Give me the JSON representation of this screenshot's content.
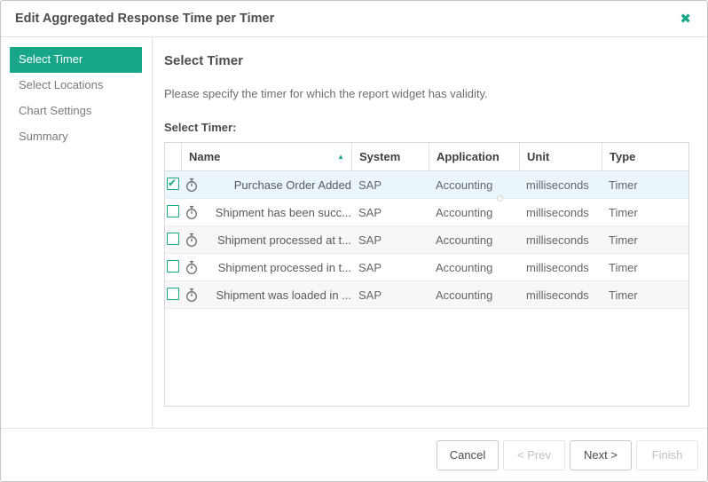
{
  "dialog": {
    "title": "Edit Aggregated Response Time per Timer",
    "close_glyph": "✖"
  },
  "colors": {
    "accent": "#18a689",
    "selected_row": "#eaf6fc",
    "alt_row": "#f7f7f7"
  },
  "sidebar": {
    "items": [
      {
        "label": "Select Timer",
        "active": true
      },
      {
        "label": "Select Locations",
        "active": false
      },
      {
        "label": "Chart Settings",
        "active": false
      },
      {
        "label": "Summary",
        "active": false
      }
    ]
  },
  "main": {
    "heading": "Select Timer",
    "description": "Please specify the timer for which the report widget has validity.",
    "table_label": "Select Timer:",
    "table": {
      "columns": {
        "name": "Name",
        "system": "System",
        "application": "Application",
        "unit": "Unit",
        "type": "Type"
      },
      "sort": {
        "column": "Name",
        "direction": "asc",
        "glyph": "▲"
      },
      "row_icon": "stopwatch-icon",
      "rows": [
        {
          "checked": true,
          "selected": true,
          "name": "Purchase Order Added",
          "system": "SAP",
          "application": "Accounting",
          "unit": "milliseconds",
          "type": "Timer"
        },
        {
          "checked": false,
          "selected": false,
          "name": "Shipment has been succ...",
          "system": "SAP",
          "application": "Accounting",
          "unit": "milliseconds",
          "type": "Timer"
        },
        {
          "checked": false,
          "selected": false,
          "name": "Shipment processed at t...",
          "system": "SAP",
          "application": "Accounting",
          "unit": "milliseconds",
          "type": "Timer"
        },
        {
          "checked": false,
          "selected": false,
          "name": "Shipment processed in t...",
          "system": "SAP",
          "application": "Accounting",
          "unit": "milliseconds",
          "type": "Timer"
        },
        {
          "checked": false,
          "selected": false,
          "name": "Shipment was loaded in ...",
          "system": "SAP",
          "application": "Accounting",
          "unit": "milliseconds",
          "type": "Timer"
        }
      ]
    }
  },
  "footer": {
    "buttons": [
      {
        "label": "Cancel",
        "enabled": true
      },
      {
        "label": "< Prev",
        "enabled": false
      },
      {
        "label": "Next >",
        "enabled": true
      },
      {
        "label": "Finish",
        "enabled": false
      }
    ]
  }
}
